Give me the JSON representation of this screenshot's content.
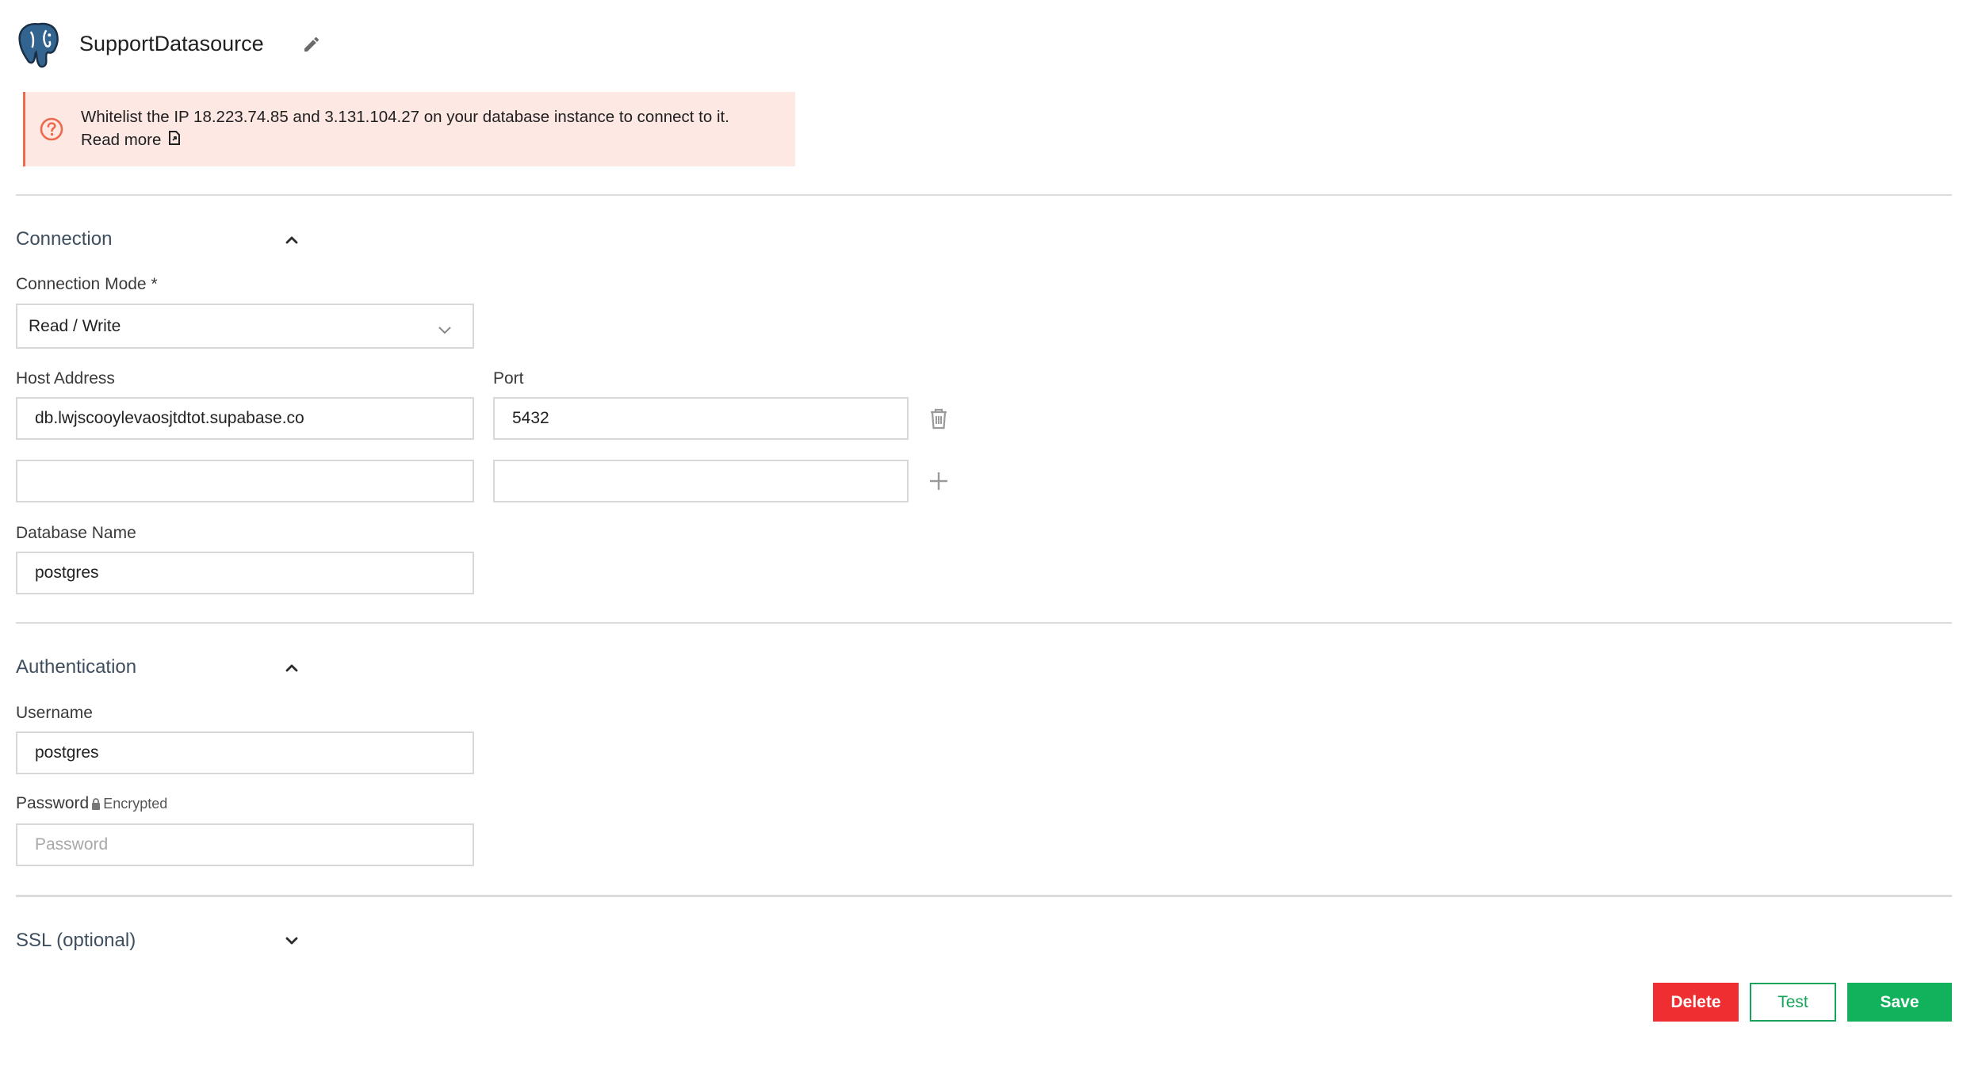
{
  "header": {
    "datasource_name": "SupportDatasource",
    "logo_icon": "postgresql-elephant-icon",
    "edit_icon": "pencil-icon"
  },
  "banner": {
    "text": "Whitelist the IP 18.223.74.85 and 3.131.104.27 on your database instance to connect to it.",
    "link_label": "Read more",
    "icon": "question-circle-icon",
    "accent_color": "#ed6a4f",
    "background_color": "#fde8e4"
  },
  "connection": {
    "section_title": "Connection",
    "mode_label": "Connection Mode *",
    "mode_value": "Read / Write",
    "host_label": "Host Address",
    "port_label": "Port",
    "hosts": [
      {
        "host": "db.lwjscooylevaosjtdtot.supabase.co",
        "port": "5432",
        "action_icon": "trash-icon"
      },
      {
        "host": "",
        "port": "",
        "action_icon": "plus-icon"
      }
    ],
    "database_label": "Database Name",
    "database_value": "postgres"
  },
  "authentication": {
    "section_title": "Authentication",
    "username_label": "Username",
    "username_value": "postgres",
    "password_label": "Password",
    "encrypted_label": "Encrypted",
    "password_placeholder": "Password"
  },
  "ssl": {
    "section_title": "SSL (optional)"
  },
  "actions": {
    "delete_label": "Delete",
    "test_label": "Test",
    "save_label": "Save",
    "delete_color": "#ee2e31",
    "save_color": "#12b15c"
  }
}
